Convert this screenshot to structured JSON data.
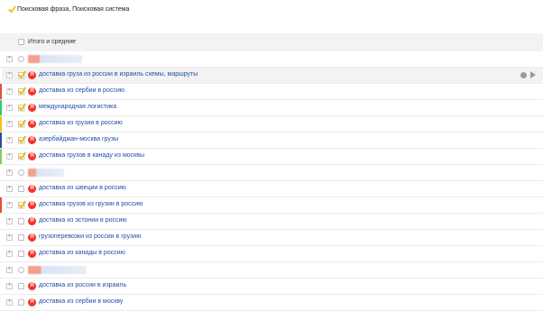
{
  "header": {
    "title": "Поисковая фраза, Поисковая система",
    "accent": "#f5b800"
  },
  "totals": {
    "label": "Итого и средние"
  },
  "colors": {
    "accent_check": "#f5b800",
    "link": "#1f4ea8",
    "yandex_red": "#f2322d"
  },
  "rows": [
    {
      "type": "group",
      "selected": false
    },
    {
      "type": "item",
      "selected": true,
      "text": "доставка груза из россии в израиль схемы, маршруты",
      "highlighted": true,
      "accent": "#ffffff",
      "icon": "yandex-icon"
    },
    {
      "type": "item",
      "selected": true,
      "text": "доставка из сербии в россию",
      "accent": "#e74c3c",
      "icon": "yandex-icon"
    },
    {
      "type": "item",
      "selected": true,
      "text": "международная логистика",
      "accent": "#2ecc71",
      "icon": "yandex-icon"
    },
    {
      "type": "item",
      "selected": true,
      "text": "доставка из грузии в россию",
      "accent": "#f1c40f",
      "icon": "yandex-icon"
    },
    {
      "type": "item",
      "selected": true,
      "text": "азербайджан-москва грузы",
      "accent": "#2b4b9b",
      "icon": "yandex-icon"
    },
    {
      "type": "item",
      "selected": true,
      "text": "доставка грузов в канаду из москвы",
      "accent": "#7fcf5e",
      "icon": "yandex-icon"
    },
    {
      "type": "group",
      "selected": false
    },
    {
      "type": "item",
      "selected": false,
      "text": "доставка из швеции в россию",
      "accent": "",
      "icon": "yandex-icon"
    },
    {
      "type": "item",
      "selected": true,
      "text": "доставка грузов из грузии в россию",
      "accent": "#e74c3c",
      "icon": "yandex-icon"
    },
    {
      "type": "item",
      "selected": false,
      "text": "доставка из эстонии в россию",
      "accent": "",
      "icon": "yandex-icon"
    },
    {
      "type": "item",
      "selected": false,
      "text": "грузоперевозки из россии в грузию",
      "accent": "",
      "icon": "yandex-icon"
    },
    {
      "type": "item",
      "selected": false,
      "text": "доставка из канады в россию",
      "accent": "",
      "icon": "yandex-icon"
    },
    {
      "type": "group",
      "selected": false
    },
    {
      "type": "item",
      "selected": false,
      "text": "доставка из россии в израиль",
      "accent": "",
      "icon": "yandex-icon"
    },
    {
      "type": "item",
      "selected": false,
      "text": "доставка из сербии в москву",
      "accent": "",
      "icon": "yandex-icon"
    }
  ]
}
